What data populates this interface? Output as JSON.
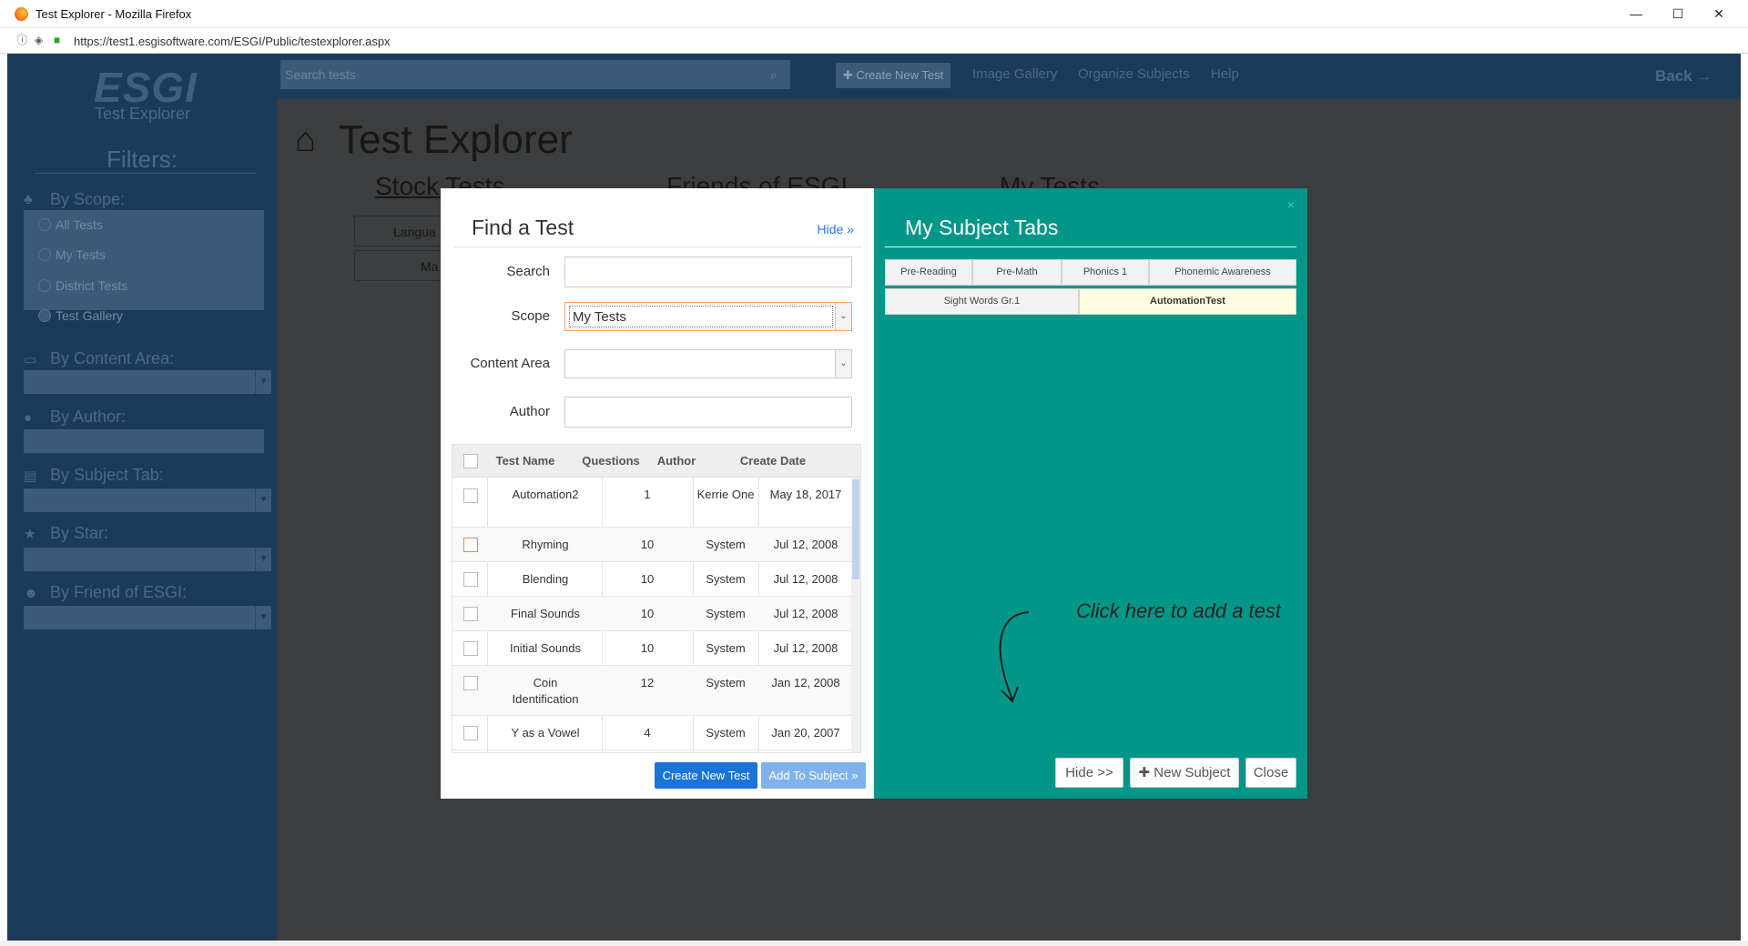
{
  "browser": {
    "window_title": "Test Explorer - Mozilla Firefox",
    "url": "https://test1.esgisoftware.com/ESGI/Public/testexplorer.aspx",
    "controls": {
      "minimize": "—",
      "maximize": "☐",
      "close": "✕"
    }
  },
  "sidebar": {
    "logo": "ESGI",
    "logo_sub": "Test Explorer",
    "filters_title": "Filters:",
    "by_scope": {
      "label": "By Scope:",
      "options": [
        "All Tests",
        "My Tests",
        "District Tests",
        "Test Gallery"
      ]
    },
    "by_content_area": {
      "label": "By Content Area:"
    },
    "by_author": {
      "label": "By Author:"
    },
    "by_subject_tab": {
      "label": "By Subject Tab:"
    },
    "by_star": {
      "label": "By Star:"
    },
    "by_friend": {
      "label": "By Friend of ESGI:"
    }
  },
  "topnav": {
    "search_placeholder": "Search tests",
    "create_new_test": "Create New Test",
    "links": [
      "Image Gallery",
      "Organize Subjects",
      "Help"
    ],
    "back": "Back"
  },
  "main": {
    "title": "Test Explorer",
    "tab_headers": [
      "Stock Tests",
      "Friends of ESGI",
      "My Tests"
    ],
    "ghost_buttons": [
      "Langua",
      "Ma"
    ]
  },
  "find_test": {
    "title": "Find a Test",
    "hide": "Hide",
    "search_label": "Search",
    "search_value": "",
    "scope_label": "Scope",
    "scope_value": "My Tests",
    "content_area_label": "Content Area",
    "content_area_value": "",
    "author_label": "Author",
    "author_value": "",
    "columns": [
      "Test Name",
      "Questions",
      "Author",
      "Create Date"
    ],
    "rows": [
      {
        "name": "Automation2",
        "questions": "1",
        "author": "Kerrie One",
        "date": "May 18, 2017"
      },
      {
        "name": "Rhyming",
        "questions": "10",
        "author": "System",
        "date": "Jul 12, 2008"
      },
      {
        "name": "Blending",
        "questions": "10",
        "author": "System",
        "date": "Jul 12, 2008"
      },
      {
        "name": "Final Sounds",
        "questions": "10",
        "author": "System",
        "date": "Jul 12, 2008"
      },
      {
        "name": "Initial Sounds",
        "questions": "10",
        "author": "System",
        "date": "Jul 12, 2008"
      },
      {
        "name": "Coin Identification",
        "questions": "12",
        "author": "System",
        "date": "Jan 12, 2008"
      },
      {
        "name": "Y as a Vowel",
        "questions": "4",
        "author": "System",
        "date": "Jan 20, 2007"
      }
    ],
    "create_button": "Create New Test",
    "add_button": "Add To Subject"
  },
  "subject_tabs": {
    "title": "My Subject Tabs",
    "close_x": "×",
    "tabs_row1": [
      "Pre-Reading",
      "Pre-Math",
      "Phonics 1",
      "Phonemic Awareness"
    ],
    "tabs_row2": [
      "Sight Words Gr.1",
      "AutomationTest"
    ],
    "active_tab": "AutomationTest",
    "cta": "Click here to add a test",
    "hide_button": "Hide >>",
    "new_subject_button": "New Subject",
    "close_button": "Close"
  },
  "colors": {
    "accent": "#009688",
    "primary": "#1a73d9",
    "sidebar": "#1c3b59"
  }
}
